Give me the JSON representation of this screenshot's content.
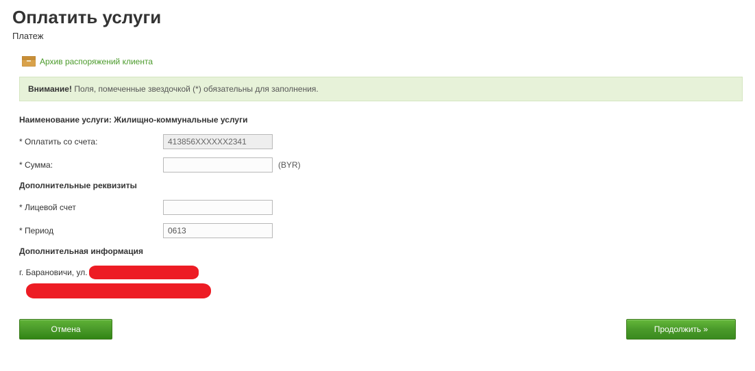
{
  "page": {
    "title": "Оплатить услуги",
    "subtitle": "Платеж"
  },
  "archive": {
    "link_text": "Архив распоряжений клиента"
  },
  "notice": {
    "prefix": "Внимание!",
    "text": " Поля, помеченные звездочкой (*) обязательны для заполнения."
  },
  "service": {
    "label_prefix": "Наименование услуги: ",
    "name": "Жилищно-коммунальные услуги"
  },
  "fields": {
    "account_label": "* Оплатить со счета:",
    "account_value": "413856XXXXXX2341",
    "amount_label": "* Сумма:",
    "amount_value": "",
    "currency": "(BYR)"
  },
  "additional_req": {
    "heading": "Дополнительные реквизиты",
    "personal_account_label": "* Лицевой счет",
    "personal_account_value": "",
    "period_label": "* Период",
    "period_value": "0613"
  },
  "additional_info": {
    "heading": "Дополнительная информация",
    "address_prefix": "г. Барановичи, ул. "
  },
  "buttons": {
    "cancel": "Отмена",
    "continue": "Продолжить »"
  }
}
